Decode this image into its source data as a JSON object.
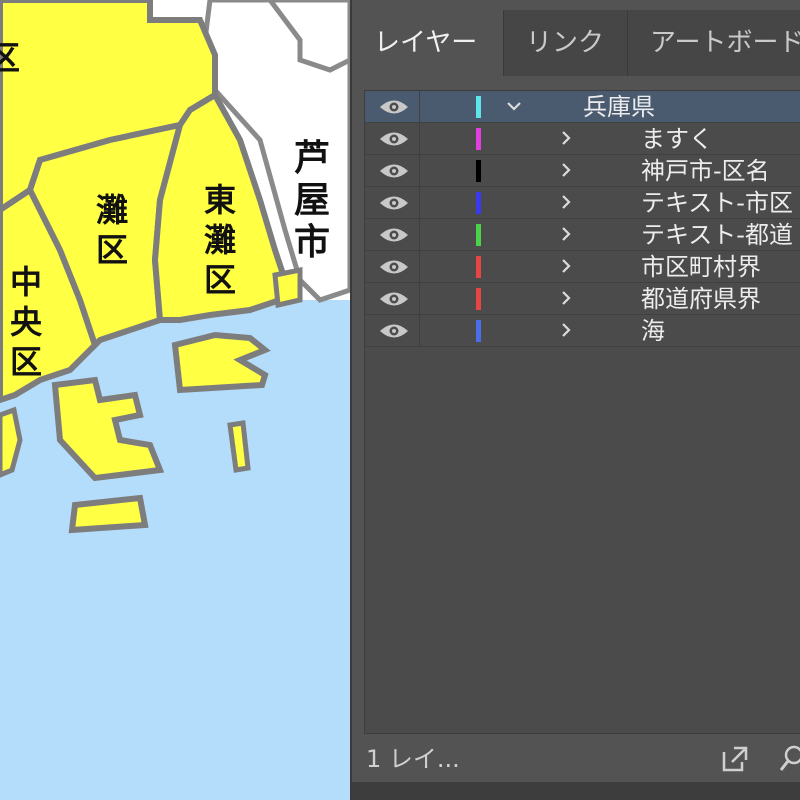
{
  "map": {
    "labels": {
      "ward_fragment": "区",
      "nada": "灘区",
      "higashinada": "東灘区",
      "chuo": "中央区",
      "ashiya": "芦屋市"
    },
    "colors": {
      "land": "#ffff44",
      "border": "#7d7d7d",
      "sea": "#b3ddfb",
      "neighbor": "#ffffff"
    }
  },
  "panel": {
    "tabs": [
      {
        "label": "レイヤー",
        "active": true
      },
      {
        "label": "リンク",
        "active": false
      },
      {
        "label": "アートボード",
        "active": false
      }
    ],
    "layers": [
      {
        "name": "兵庫県",
        "color": "#5ee6e6",
        "expanded": true,
        "selected": true
      },
      {
        "name": "ますく",
        "color": "#e040e0"
      },
      {
        "name": "神戸市-区名",
        "color": "#000000"
      },
      {
        "name": "テキスト-市区",
        "color": "#3a3af0"
      },
      {
        "name": "テキスト-都道",
        "color": "#4ad24a"
      },
      {
        "name": "市区町村界",
        "color": "#e84646"
      },
      {
        "name": "都道府県界",
        "color": "#e84646"
      },
      {
        "name": "海",
        "color": "#4a6ee8"
      }
    ],
    "footer": {
      "layer_count": "1 レイ..."
    },
    "icons": {
      "visibility": "eye-icon",
      "expand": "chevron-icon",
      "export": "export-icon",
      "search": "search-icon"
    }
  }
}
